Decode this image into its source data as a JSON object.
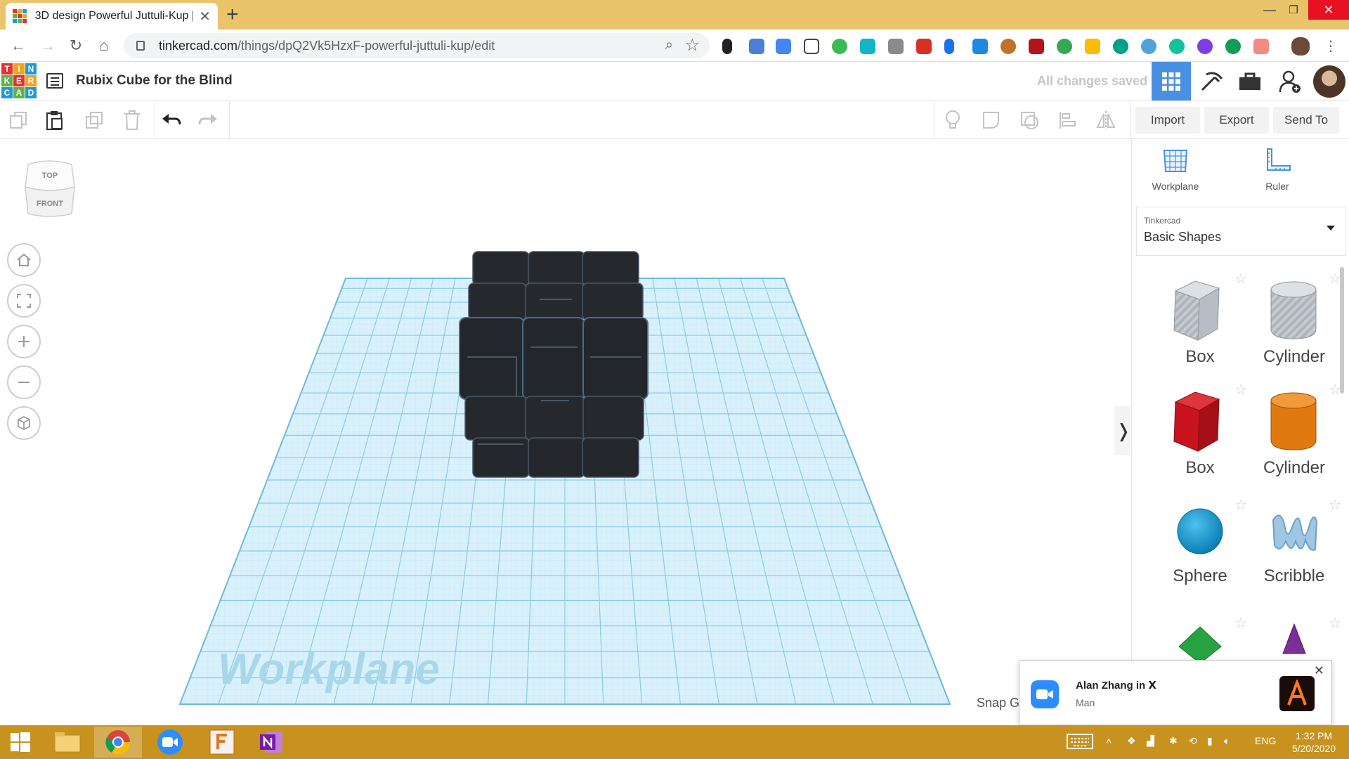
{
  "browser": {
    "tab_title": "3D design Powerful Juttuli-Kup |",
    "url_host": "tinkercad.com",
    "url_path": "/things/dpQ2Vk5HzxF-powerful-juttuli-kup/edit"
  },
  "header": {
    "logo_letters": [
      "T",
      "I",
      "N",
      "K",
      "E",
      "R",
      "C",
      "A",
      "D"
    ],
    "design_title": "Rubix Cube for the Blind",
    "save_status": "All changes saved"
  },
  "edit_bar": {
    "import_label": "Import",
    "export_label": "Export",
    "send_to_label": "Send To"
  },
  "workspace": {
    "viewcube_top": "TOP",
    "viewcube_front": "FRONT",
    "workplane_label": "Workplane",
    "snap_label": "Snap G"
  },
  "panel": {
    "workplane_label": "Workplane",
    "ruler_label": "Ruler",
    "library_category": "Tinkercad",
    "library_value": "Basic Shapes",
    "shapes": [
      {
        "label": "Box",
        "icon": "striped-box-icon"
      },
      {
        "label": "Cylinder",
        "icon": "striped-cylinder-icon"
      },
      {
        "label": "Box",
        "icon": "red-box-icon"
      },
      {
        "label": "Cylinder",
        "icon": "orange-cylinder-icon"
      },
      {
        "label": "Sphere",
        "icon": "blue-sphere-icon"
      },
      {
        "label": "Scribble",
        "icon": "scribble-icon"
      }
    ]
  },
  "notification": {
    "title": "Alan Zhang in Ⅹ",
    "body": "Man"
  },
  "taskbar": {
    "language": "ENG",
    "time": "1:32 PM",
    "date": "5/20/2020"
  },
  "colors": {
    "tab_strip": "#e9c46a",
    "accent_blue": "#4a90e2",
    "grid_blue": "#9fd8ef",
    "cube_dark": "#25292e",
    "taskbar": "#c8921f"
  }
}
